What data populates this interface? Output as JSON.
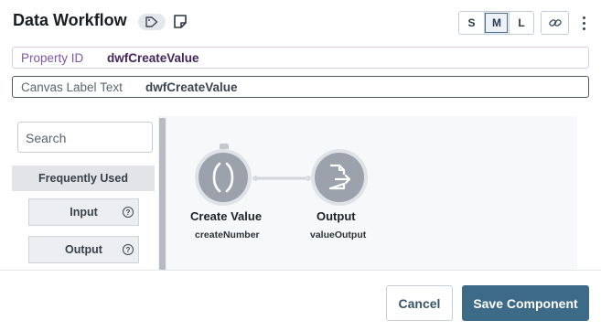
{
  "header": {
    "title": "Data Workflow",
    "tag_icon": "tag-icon",
    "note_icon": "note-icon",
    "sizes": [
      "S",
      "M",
      "L"
    ],
    "active_size": "M",
    "link_icon": "link-icon",
    "more_icon": "kebab-menu-icon"
  },
  "fields": {
    "property_id": {
      "label": "Property ID",
      "value": "dwfCreateValue"
    },
    "canvas_label": {
      "label": "Canvas Label Text",
      "value": "dwfCreateValue"
    }
  },
  "palette": {
    "search_placeholder": "Search",
    "section": "Frequently Used",
    "items": [
      {
        "label": "Input",
        "help": "?"
      },
      {
        "label": "Output",
        "help": "?"
      }
    ]
  },
  "canvas": {
    "nodes": [
      {
        "title": "Create Value",
        "subtitle": "createNumber",
        "icon": "parentheses-icon"
      },
      {
        "title": "Output",
        "subtitle": "valueOutput",
        "icon": "file-export-icon"
      }
    ]
  },
  "footer": {
    "cancel_label": "Cancel",
    "save_label": "Save Component"
  },
  "colors": {
    "primary": "#3d6b87",
    "property_label": "#7d57a8",
    "node_fill": "#9ba2ab"
  }
}
